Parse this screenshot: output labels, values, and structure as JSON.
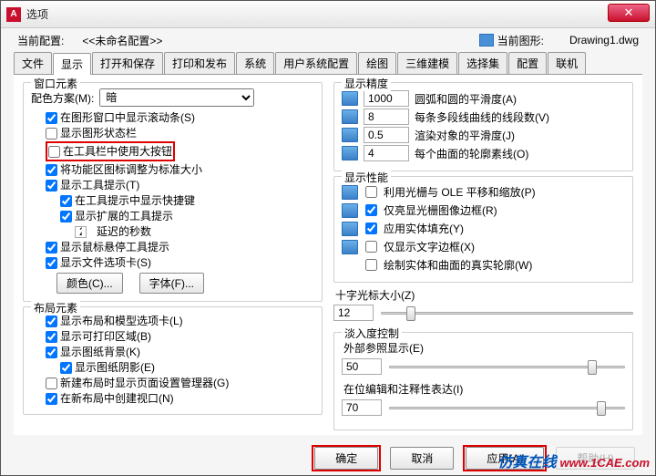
{
  "title": "选项",
  "profile": {
    "label": "当前配置:",
    "value": "<<未命名配置>>",
    "drawing_label": "当前图形:",
    "drawing_value": "Drawing1.dwg"
  },
  "tabs": [
    "文件",
    "显示",
    "打开和保存",
    "打印和发布",
    "系统",
    "用户系统配置",
    "绘图",
    "三维建模",
    "选择集",
    "配置",
    "联机"
  ],
  "active_tab": 1,
  "window_elements": {
    "title": "窗口元素",
    "scheme_label": "配色方案(M):",
    "scheme_value": "暗",
    "show_scroll": "在图形窗口中显示滚动条(S)",
    "show_statusbar": "显示图形状态栏",
    "large_buttons": "在工具栏中使用大按钮",
    "resize_ribbon": "将功能区图标调整为标准大小",
    "show_tooltips": "显示工具提示(T)",
    "show_shortcut": "在工具提示中显示快捷键",
    "show_ext_tip": "显示扩展的工具提示",
    "delay_value": "2",
    "delay_label": "延迟的秒数",
    "show_hover": "显示鼠标悬停工具提示",
    "show_file_tabs": "显示文件选项卡(S)",
    "color_btn": "颜色(C)...",
    "font_btn": "字体(F)..."
  },
  "layout_elements": {
    "title": "布局元素",
    "show_tabs": "显示布局和模型选项卡(L)",
    "show_print": "显示可打印区域(B)",
    "show_bg": "显示图纸背景(K)",
    "show_shadow": "显示图纸阴影(E)",
    "page_setup": "新建布局时显示页面设置管理器(G)",
    "create_vp": "在新布局中创建视口(N)"
  },
  "display_precision": {
    "title": "显示精度",
    "r1v": "1000",
    "r1t": "圆弧和圆的平滑度(A)",
    "r2v": "8",
    "r2t": "每条多段线曲线的线段数(V)",
    "r3v": "0.5",
    "r3t": "渲染对象的平滑度(J)",
    "r4v": "4",
    "r4t": "每个曲面的轮廓素线(O)"
  },
  "display_perf": {
    "title": "显示性能",
    "p1": "利用光栅与 OLE 平移和缩放(P)",
    "p2": "仅亮显光栅图像边框(R)",
    "p3": "应用实体填充(Y)",
    "p4": "仅显示文字边框(X)",
    "p5": "绘制实体和曲面的真实轮廓(W)"
  },
  "crosshair": {
    "title": "十字光标大小(Z)",
    "value": "12"
  },
  "fade": {
    "title": "淡入度控制",
    "xref_label": "外部参照显示(E)",
    "xref_value": "50",
    "edit_label": "在位编辑和注释性表达(I)",
    "edit_value": "70"
  },
  "footer": {
    "ok": "确定",
    "cancel": "取消",
    "apply": "应用(A)",
    "help": "帮助(H)"
  },
  "watermark": {
    "cn": "仿真在线",
    "url": "www.1CAE.com"
  }
}
